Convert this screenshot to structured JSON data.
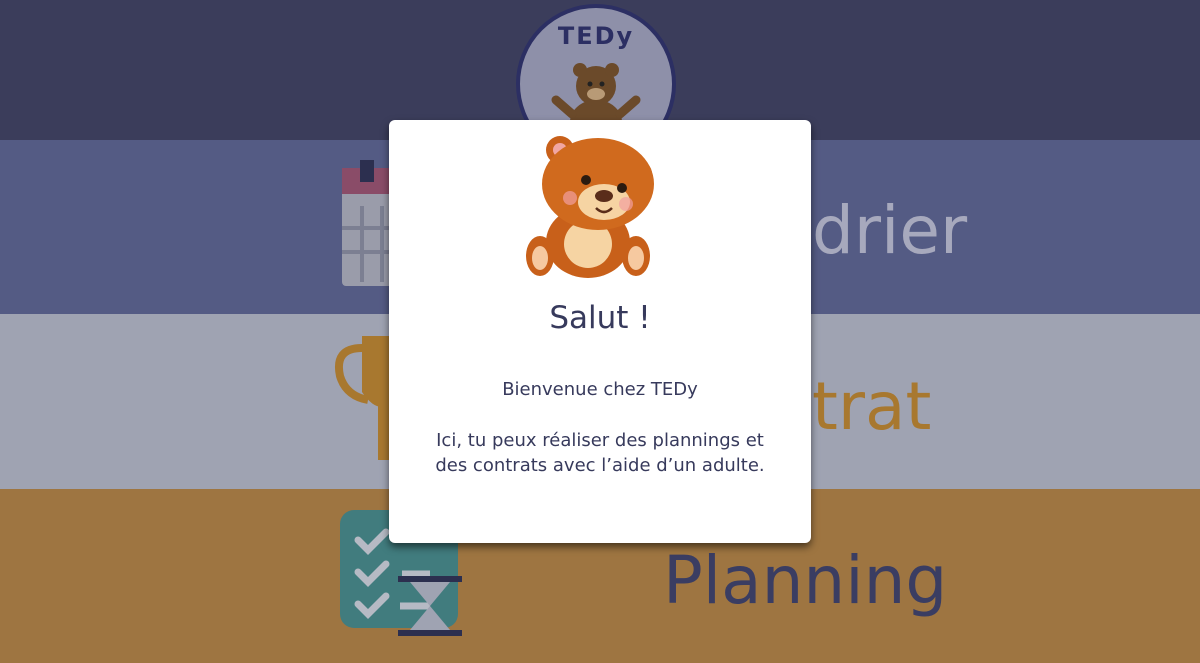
{
  "app": {
    "logo_text": "TEDy"
  },
  "menu": [
    {
      "label": "Calendrier",
      "visible_label": "drier",
      "icon": "calendar-icon",
      "color": "#a7a9bd"
    },
    {
      "label": "Contrat",
      "visible_label": "trat",
      "icon": "trophy-icon",
      "color": "#a8782f"
    },
    {
      "label": "Planning",
      "visible_label": "Planning",
      "icon": "checklist-hourglass-icon",
      "color": "#3a3d62"
    }
  ],
  "modal": {
    "title": "Salut !",
    "welcome": "Bienvenue chez TEDy",
    "body_line1": "Ici, tu peux réaliser des plannings et",
    "body_line2": "des contrats avec l’aide d’un adulte.",
    "mascot": "teddy-bear-icon"
  },
  "colors": {
    "header": "#3b3d5b",
    "calendar_band": "#545b84",
    "contract_band": "#9fa3b2",
    "planning_band": "#9e7541",
    "text": "#373a5c"
  }
}
